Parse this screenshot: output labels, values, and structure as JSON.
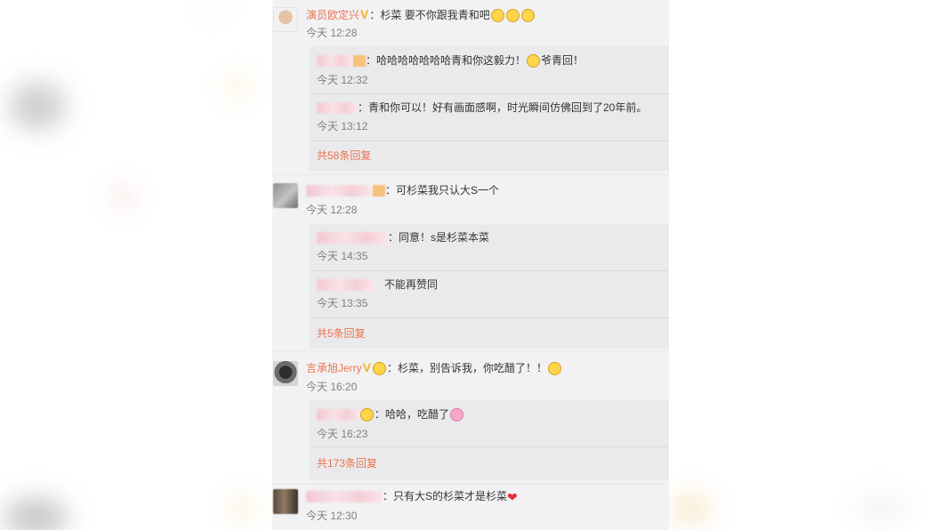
{
  "comments": [
    {
      "user": "演员欧定兴",
      "verified_icon": "V",
      "text": "：杉菜 要不你跟我青和吧",
      "time": "今天 12:28",
      "replies": [
        {
          "text": "：哈哈哈哈哈哈哈青和你这毅力！",
          "text_after": "爷青回！",
          "time": "今天 12:32"
        },
        {
          "text": "：青和你可以！好有画面感啊，时光瞬间仿佛回到了20年前。",
          "time": "今天 13:12"
        }
      ],
      "more": "共58条回复"
    },
    {
      "text": "：可杉菜我只认大S一个",
      "time": "今天 12:28",
      "replies": [
        {
          "text": "：同意！s是杉菜本菜",
          "time": "今天 14:35"
        },
        {
          "text": "不能再赞同",
          "time": "今天 13:35"
        }
      ],
      "more": "共5条回复"
    },
    {
      "user": "言承旭Jerry",
      "verified_icon": "V",
      "text": "：杉菜，别告诉我，你吃醋了！！",
      "time": "今天 16:20",
      "replies": [
        {
          "text": "：哈哈，吃醋了",
          "time": "今天 16:23"
        }
      ],
      "more": "共173条回复"
    },
    {
      "text": "：只有大S的杉菜才是杉菜",
      "time": "今天 12:30"
    }
  ],
  "icons": {
    "verify": "verified-v-icon",
    "heart": "❤",
    "heart_color": "#e0333d",
    "username_color": "#eb7350"
  }
}
